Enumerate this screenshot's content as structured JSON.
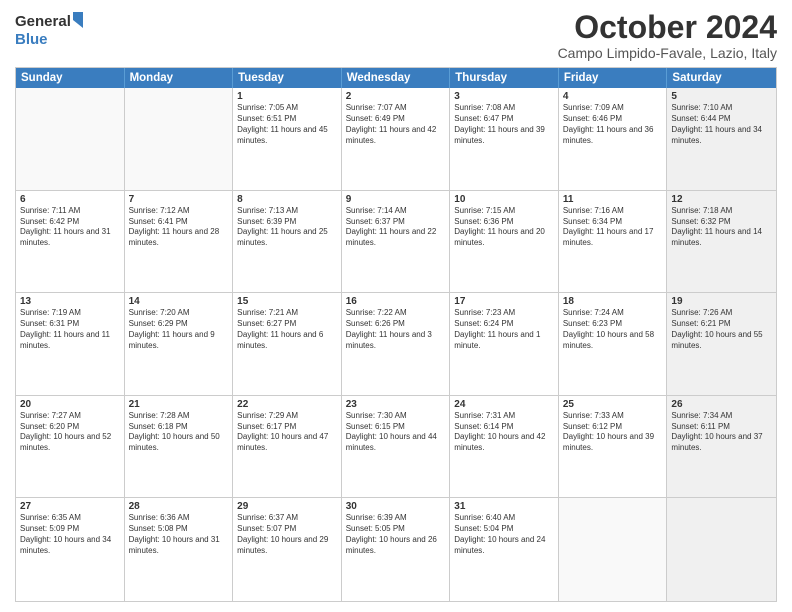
{
  "logo": {
    "general": "General",
    "blue": "Blue"
  },
  "title": "October 2024",
  "location": "Campo Limpido-Favale, Lazio, Italy",
  "weekdays": [
    "Sunday",
    "Monday",
    "Tuesday",
    "Wednesday",
    "Thursday",
    "Friday",
    "Saturday"
  ],
  "rows": [
    [
      {
        "day": "",
        "sunrise": "",
        "sunset": "",
        "daylight": "",
        "shaded": false,
        "empty": true
      },
      {
        "day": "",
        "sunrise": "",
        "sunset": "",
        "daylight": "",
        "shaded": false,
        "empty": true
      },
      {
        "day": "1",
        "sunrise": "Sunrise: 7:05 AM",
        "sunset": "Sunset: 6:51 PM",
        "daylight": "Daylight: 11 hours and 45 minutes.",
        "shaded": false,
        "empty": false
      },
      {
        "day": "2",
        "sunrise": "Sunrise: 7:07 AM",
        "sunset": "Sunset: 6:49 PM",
        "daylight": "Daylight: 11 hours and 42 minutes.",
        "shaded": false,
        "empty": false
      },
      {
        "day": "3",
        "sunrise": "Sunrise: 7:08 AM",
        "sunset": "Sunset: 6:47 PM",
        "daylight": "Daylight: 11 hours and 39 minutes.",
        "shaded": false,
        "empty": false
      },
      {
        "day": "4",
        "sunrise": "Sunrise: 7:09 AM",
        "sunset": "Sunset: 6:46 PM",
        "daylight": "Daylight: 11 hours and 36 minutes.",
        "shaded": false,
        "empty": false
      },
      {
        "day": "5",
        "sunrise": "Sunrise: 7:10 AM",
        "sunset": "Sunset: 6:44 PM",
        "daylight": "Daylight: 11 hours and 34 minutes.",
        "shaded": true,
        "empty": false
      }
    ],
    [
      {
        "day": "6",
        "sunrise": "Sunrise: 7:11 AM",
        "sunset": "Sunset: 6:42 PM",
        "daylight": "Daylight: 11 hours and 31 minutes.",
        "shaded": false,
        "empty": false
      },
      {
        "day": "7",
        "sunrise": "Sunrise: 7:12 AM",
        "sunset": "Sunset: 6:41 PM",
        "daylight": "Daylight: 11 hours and 28 minutes.",
        "shaded": false,
        "empty": false
      },
      {
        "day": "8",
        "sunrise": "Sunrise: 7:13 AM",
        "sunset": "Sunset: 6:39 PM",
        "daylight": "Daylight: 11 hours and 25 minutes.",
        "shaded": false,
        "empty": false
      },
      {
        "day": "9",
        "sunrise": "Sunrise: 7:14 AM",
        "sunset": "Sunset: 6:37 PM",
        "daylight": "Daylight: 11 hours and 22 minutes.",
        "shaded": false,
        "empty": false
      },
      {
        "day": "10",
        "sunrise": "Sunrise: 7:15 AM",
        "sunset": "Sunset: 6:36 PM",
        "daylight": "Daylight: 11 hours and 20 minutes.",
        "shaded": false,
        "empty": false
      },
      {
        "day": "11",
        "sunrise": "Sunrise: 7:16 AM",
        "sunset": "Sunset: 6:34 PM",
        "daylight": "Daylight: 11 hours and 17 minutes.",
        "shaded": false,
        "empty": false
      },
      {
        "day": "12",
        "sunrise": "Sunrise: 7:18 AM",
        "sunset": "Sunset: 6:32 PM",
        "daylight": "Daylight: 11 hours and 14 minutes.",
        "shaded": true,
        "empty": false
      }
    ],
    [
      {
        "day": "13",
        "sunrise": "Sunrise: 7:19 AM",
        "sunset": "Sunset: 6:31 PM",
        "daylight": "Daylight: 11 hours and 11 minutes.",
        "shaded": false,
        "empty": false
      },
      {
        "day": "14",
        "sunrise": "Sunrise: 7:20 AM",
        "sunset": "Sunset: 6:29 PM",
        "daylight": "Daylight: 11 hours and 9 minutes.",
        "shaded": false,
        "empty": false
      },
      {
        "day": "15",
        "sunrise": "Sunrise: 7:21 AM",
        "sunset": "Sunset: 6:27 PM",
        "daylight": "Daylight: 11 hours and 6 minutes.",
        "shaded": false,
        "empty": false
      },
      {
        "day": "16",
        "sunrise": "Sunrise: 7:22 AM",
        "sunset": "Sunset: 6:26 PM",
        "daylight": "Daylight: 11 hours and 3 minutes.",
        "shaded": false,
        "empty": false
      },
      {
        "day": "17",
        "sunrise": "Sunrise: 7:23 AM",
        "sunset": "Sunset: 6:24 PM",
        "daylight": "Daylight: 11 hours and 1 minute.",
        "shaded": false,
        "empty": false
      },
      {
        "day": "18",
        "sunrise": "Sunrise: 7:24 AM",
        "sunset": "Sunset: 6:23 PM",
        "daylight": "Daylight: 10 hours and 58 minutes.",
        "shaded": false,
        "empty": false
      },
      {
        "day": "19",
        "sunrise": "Sunrise: 7:26 AM",
        "sunset": "Sunset: 6:21 PM",
        "daylight": "Daylight: 10 hours and 55 minutes.",
        "shaded": true,
        "empty": false
      }
    ],
    [
      {
        "day": "20",
        "sunrise": "Sunrise: 7:27 AM",
        "sunset": "Sunset: 6:20 PM",
        "daylight": "Daylight: 10 hours and 52 minutes.",
        "shaded": false,
        "empty": false
      },
      {
        "day": "21",
        "sunrise": "Sunrise: 7:28 AM",
        "sunset": "Sunset: 6:18 PM",
        "daylight": "Daylight: 10 hours and 50 minutes.",
        "shaded": false,
        "empty": false
      },
      {
        "day": "22",
        "sunrise": "Sunrise: 7:29 AM",
        "sunset": "Sunset: 6:17 PM",
        "daylight": "Daylight: 10 hours and 47 minutes.",
        "shaded": false,
        "empty": false
      },
      {
        "day": "23",
        "sunrise": "Sunrise: 7:30 AM",
        "sunset": "Sunset: 6:15 PM",
        "daylight": "Daylight: 10 hours and 44 minutes.",
        "shaded": false,
        "empty": false
      },
      {
        "day": "24",
        "sunrise": "Sunrise: 7:31 AM",
        "sunset": "Sunset: 6:14 PM",
        "daylight": "Daylight: 10 hours and 42 minutes.",
        "shaded": false,
        "empty": false
      },
      {
        "day": "25",
        "sunrise": "Sunrise: 7:33 AM",
        "sunset": "Sunset: 6:12 PM",
        "daylight": "Daylight: 10 hours and 39 minutes.",
        "shaded": false,
        "empty": false
      },
      {
        "day": "26",
        "sunrise": "Sunrise: 7:34 AM",
        "sunset": "Sunset: 6:11 PM",
        "daylight": "Daylight: 10 hours and 37 minutes.",
        "shaded": true,
        "empty": false
      }
    ],
    [
      {
        "day": "27",
        "sunrise": "Sunrise: 6:35 AM",
        "sunset": "Sunset: 5:09 PM",
        "daylight": "Daylight: 10 hours and 34 minutes.",
        "shaded": false,
        "empty": false
      },
      {
        "day": "28",
        "sunrise": "Sunrise: 6:36 AM",
        "sunset": "Sunset: 5:08 PM",
        "daylight": "Daylight: 10 hours and 31 minutes.",
        "shaded": false,
        "empty": false
      },
      {
        "day": "29",
        "sunrise": "Sunrise: 6:37 AM",
        "sunset": "Sunset: 5:07 PM",
        "daylight": "Daylight: 10 hours and 29 minutes.",
        "shaded": false,
        "empty": false
      },
      {
        "day": "30",
        "sunrise": "Sunrise: 6:39 AM",
        "sunset": "Sunset: 5:05 PM",
        "daylight": "Daylight: 10 hours and 26 minutes.",
        "shaded": false,
        "empty": false
      },
      {
        "day": "31",
        "sunrise": "Sunrise: 6:40 AM",
        "sunset": "Sunset: 5:04 PM",
        "daylight": "Daylight: 10 hours and 24 minutes.",
        "shaded": false,
        "empty": false
      },
      {
        "day": "",
        "sunrise": "",
        "sunset": "",
        "daylight": "",
        "shaded": false,
        "empty": true
      },
      {
        "day": "",
        "sunrise": "",
        "sunset": "",
        "daylight": "",
        "shaded": true,
        "empty": true
      }
    ]
  ]
}
